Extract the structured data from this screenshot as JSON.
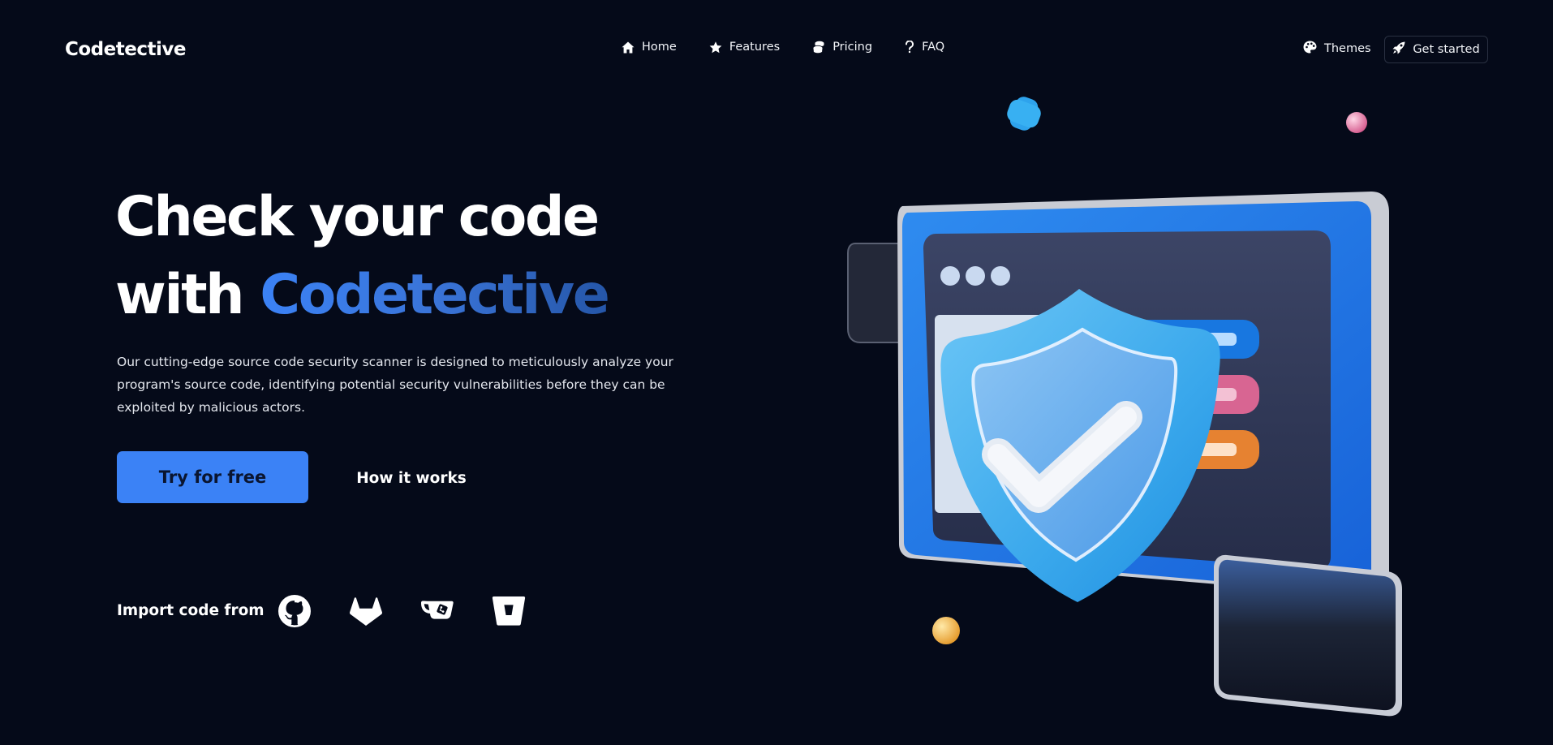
{
  "header": {
    "brand": "Codetective",
    "nav": [
      {
        "label": "Home",
        "icon": "home-icon"
      },
      {
        "label": "Features",
        "icon": "star-icon"
      },
      {
        "label": "Pricing",
        "icon": "coins-icon"
      },
      {
        "label": "FAQ",
        "icon": "question-icon"
      }
    ],
    "themes_label": "Themes",
    "get_started_label": "Get started"
  },
  "hero": {
    "title_line1": "Check your code",
    "title_line2_prefix": "with ",
    "title_line2_accent": "Codetective",
    "description": "Our cutting-edge source code security scanner is designed to meticulously analyze your program's source code, identifying potential security vulnerabilities before they can be exploited by malicious actors.",
    "primary_cta": "Try for free",
    "secondary_cta": "How it works"
  },
  "import": {
    "label": "Import code from",
    "sources": [
      "github-icon",
      "gitlab-icon",
      "gitea-icon",
      "bitbucket-icon"
    ]
  },
  "colors": {
    "background": "#050a19",
    "accent": "#3b82f6",
    "text": "#ffffff"
  }
}
